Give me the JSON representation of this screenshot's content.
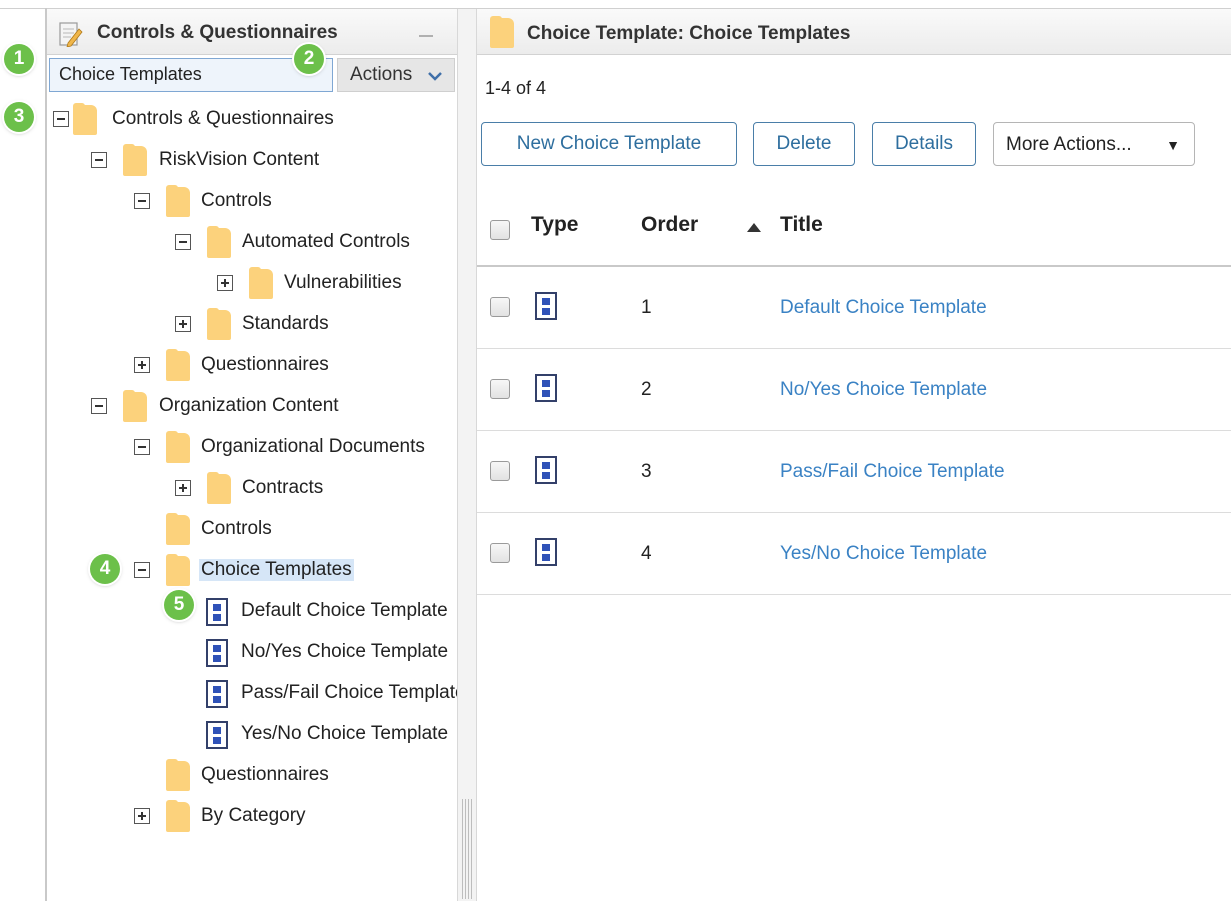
{
  "left": {
    "header_title": "Controls & Questionnaires",
    "view_select": "Choice Templates",
    "actions_label": "Actions",
    "tree": [
      {
        "label": "Controls & Questionnaires",
        "toggle": "minus",
        "icon": "folder"
      },
      {
        "label": "RiskVision Content",
        "toggle": "minus",
        "icon": "folder"
      },
      {
        "label": "Controls",
        "toggle": "minus",
        "icon": "folder"
      },
      {
        "label": "Automated Controls",
        "toggle": "minus",
        "icon": "folder"
      },
      {
        "label": "Vulnerabilities",
        "toggle": "plus",
        "icon": "folder"
      },
      {
        "label": "Standards",
        "toggle": "plus",
        "icon": "folder"
      },
      {
        "label": "Questionnaires",
        "toggle": "plus",
        "icon": "folder"
      },
      {
        "label": "Organization Content",
        "toggle": "minus",
        "icon": "folder"
      },
      {
        "label": "Organizational Documents",
        "toggle": "minus",
        "icon": "folder"
      },
      {
        "label": "Contracts",
        "toggle": "plus",
        "icon": "folder"
      },
      {
        "label": "Controls",
        "toggle": "none",
        "icon": "folder"
      },
      {
        "label": "Choice Templates",
        "toggle": "minus",
        "icon": "folder",
        "selected": true
      },
      {
        "label": "Default Choice Template",
        "toggle": "none",
        "icon": "document"
      },
      {
        "label": "No/Yes Choice Template",
        "toggle": "none",
        "icon": "document"
      },
      {
        "label": "Pass/Fail Choice Template",
        "toggle": "none",
        "icon": "document"
      },
      {
        "label": "Yes/No Choice Template",
        "toggle": "none",
        "icon": "document"
      },
      {
        "label": "Questionnaires",
        "toggle": "none",
        "icon": "folder"
      },
      {
        "label": "By Category",
        "toggle": "plus",
        "icon": "folder"
      }
    ]
  },
  "callouts": [
    "1",
    "2",
    "3",
    "4",
    "5"
  ],
  "right": {
    "header_title": "Choice Template: Choice Templates",
    "count": "1-4 of 4",
    "buttons": {
      "new": "New Choice Template",
      "delete": "Delete",
      "details": "Details",
      "more": "More Actions...",
      "more_arrow": "▼"
    },
    "columns": {
      "type": "Type",
      "order": "Order",
      "title": "Title"
    },
    "rows": [
      {
        "order": "1",
        "title": "Default Choice Template"
      },
      {
        "order": "2",
        "title": "No/Yes Choice Template"
      },
      {
        "order": "3",
        "title": "Pass/Fail Choice Template"
      },
      {
        "order": "4",
        "title": "Yes/No Choice Template"
      }
    ]
  },
  "colors": {
    "accent": "#3a82c4",
    "folder": "#fcd27c",
    "callout": "#6cc04a",
    "selection": "#d6e6f7"
  }
}
